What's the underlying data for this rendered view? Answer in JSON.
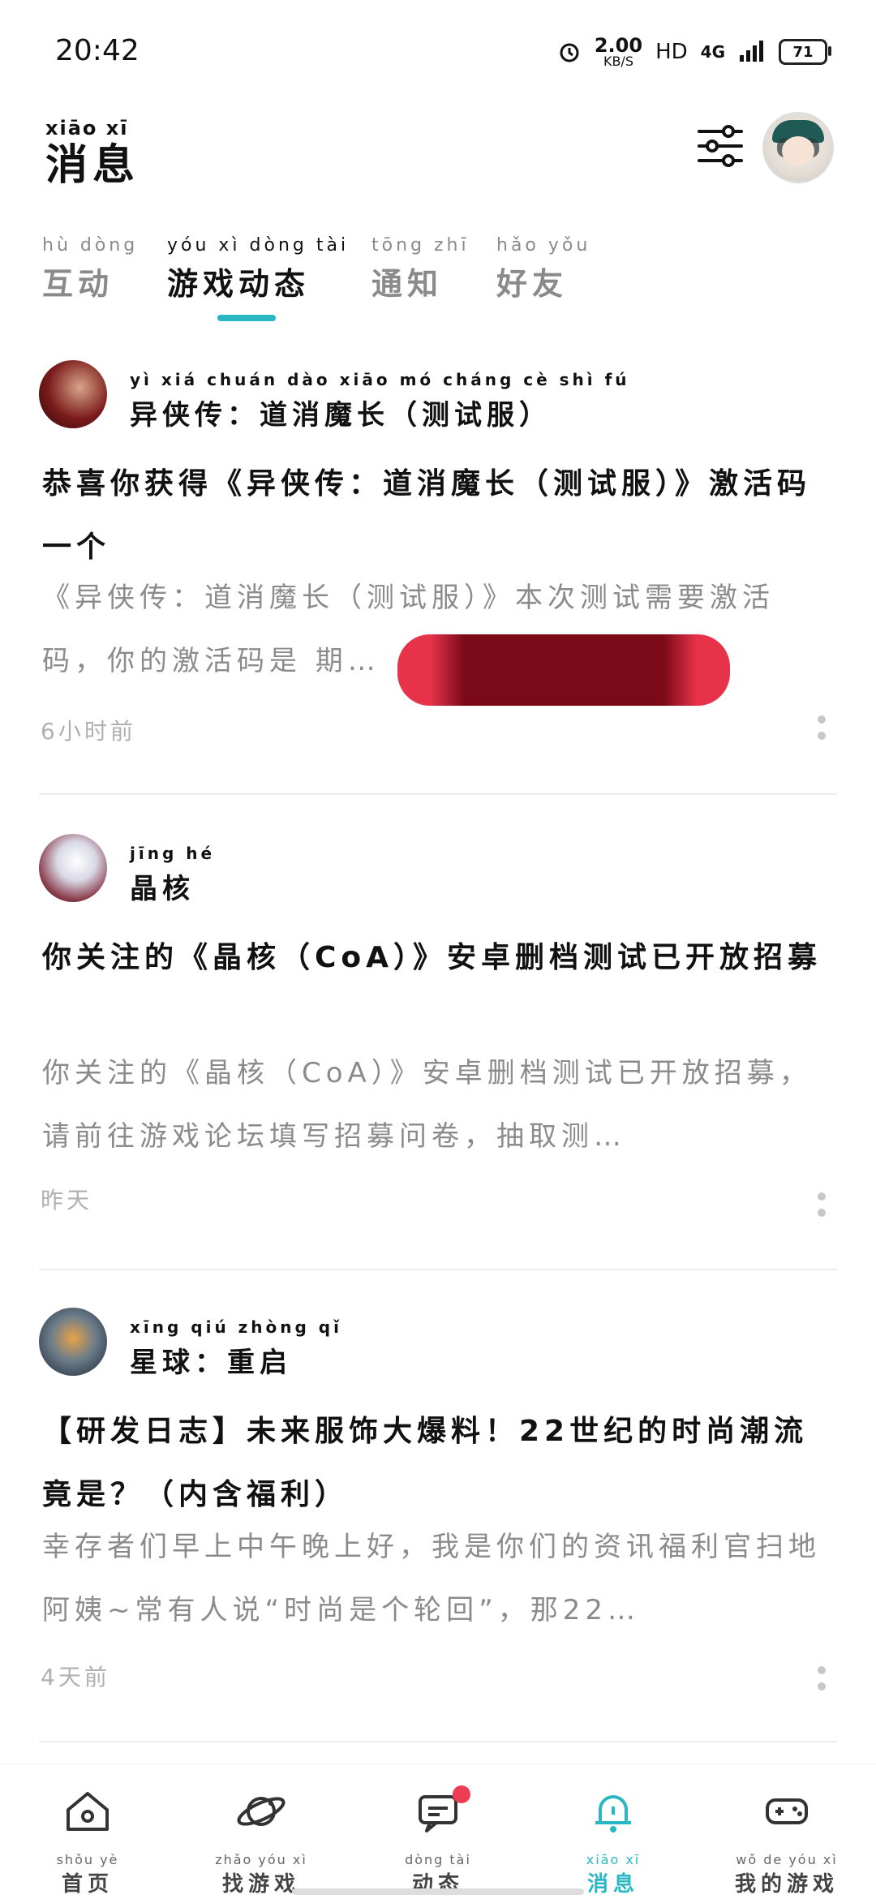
{
  "status": {
    "time": "20:42",
    "net_speed_value": "2.00",
    "net_speed_unit": "KB/S",
    "hd": "HD",
    "network": "4G",
    "battery": "71"
  },
  "header": {
    "title_pinyin": "xiāo xī",
    "title": "消息"
  },
  "tabs": [
    {
      "pinyin": "hù dòng",
      "label": "互动"
    },
    {
      "pinyin": "yóu xì dòng tài",
      "label": "游戏动态"
    },
    {
      "pinyin": "tōng zhī",
      "label": "通知"
    },
    {
      "pinyin": "hǎo yǒu",
      "label": "好友"
    }
  ],
  "cards": [
    {
      "game_pinyin": "yì xiá chuán dào xiāo mó cháng cè shì fú",
      "game": "异侠传：道消魔长（测试服）",
      "headline": "恭喜你获得《异侠传：道消魔长（测试服）》激活码一个",
      "summary": "《异侠传：道消魔长（测试服）》本次测试需要激活码，你的激活码是                   期…",
      "time": "6小时前"
    },
    {
      "game_pinyin": "jīng hé",
      "game": "晶核",
      "headline": "你关注的《晶核（CoA）》安卓删档测试已开放招募",
      "summary": "你关注的《晶核（CoA）》安卓删档测试已开放招募，请前往游戏论坛填写招募问卷，抽取测…",
      "time": "昨天"
    },
    {
      "game_pinyin": "xīng qiú zhòng qǐ",
      "game": "星球：重启",
      "headline": "【研发日志】未来服饰大爆料！22世纪的时尚潮流竟是？（内含福利）",
      "summary": "幸存者们早上中午晚上好，我是你们的资讯福利官扫地阿姨~常有人说“时尚是个轮回”，那22…",
      "time": "4天前"
    }
  ],
  "bottom_nav": [
    {
      "pinyin": "shǒu yè",
      "label": "首页",
      "icon": "home-icon"
    },
    {
      "pinyin": "zhǎo yóu xì",
      "label": "找游戏",
      "icon": "planet-icon"
    },
    {
      "pinyin": "dòng tài",
      "label": "动态",
      "icon": "chat-icon"
    },
    {
      "pinyin": "xiāo xī",
      "label": "消息",
      "icon": "bell-icon"
    },
    {
      "pinyin": "wǒ de yóu xì",
      "label": "我的游戏",
      "icon": "gamepad-icon"
    }
  ],
  "colors": {
    "accent": "#28b7c3",
    "badge": "#ef3c53"
  }
}
